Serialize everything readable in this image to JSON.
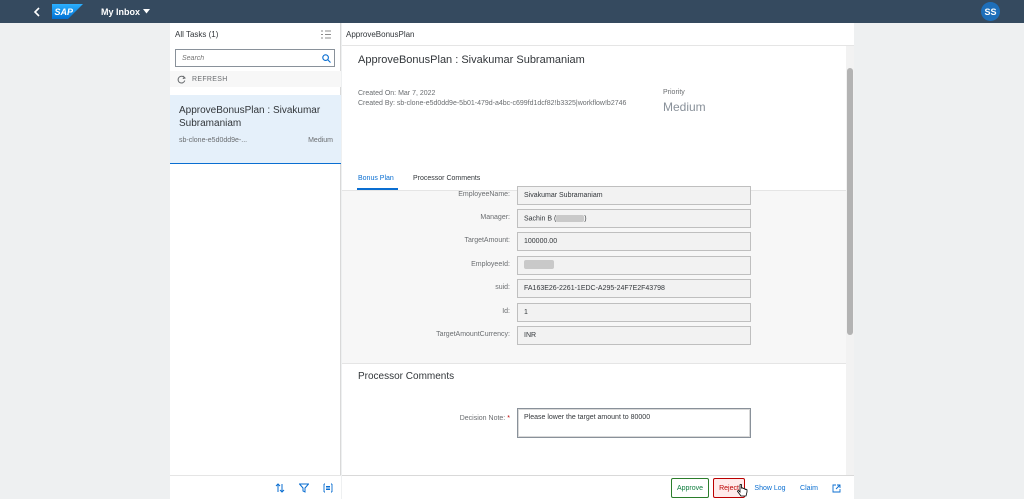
{
  "shell": {
    "brand": "SAP",
    "title": "My Inbox",
    "user_initials": "SS",
    "colors": {
      "header_bg": "#354a5f",
      "avatar_bg": "#1e6fba"
    }
  },
  "master": {
    "header_title": "All Tasks (1)",
    "search_placeholder": "Search",
    "refresh_label": "REFRESH",
    "tasks": [
      {
        "title": "ApproveBonusPlan : Sivakumar Subramaniam",
        "creator": "sb-clone-e5d0dd9e-...",
        "priority": "Medium"
      }
    ]
  },
  "detail": {
    "bar_title": "ApproveBonusPlan",
    "object_title": "ApproveBonusPlan : Sivakumar Subramaniam",
    "created_on": "Created On: Mar 7, 2022",
    "created_by": "Created By: sb-clone-e5d0dd9e-5b01-479d-a4bc-c699fd1dcf82!b3325|workflow!b2746",
    "priority_label": "Priority",
    "priority_value": "Medium",
    "tabs": [
      {
        "label": "Bonus Plan",
        "active": true
      },
      {
        "label": "Processor Comments",
        "active": false
      }
    ],
    "fields": [
      {
        "label": "EmployeeName:",
        "value": "Sivakumar Subramaniam"
      },
      {
        "label": "Manager:",
        "value": "Sachin B (",
        "value_suffix": ")"
      },
      {
        "label": "TargetAmount:",
        "value": "100000.00"
      },
      {
        "label": "EmployeeId:",
        "value": ""
      },
      {
        "label": "suid:",
        "value": "FA163E26-2261-1EDC-A295-24F7E2F43798"
      },
      {
        "label": "Id:",
        "value": "1"
      },
      {
        "label": "TargetAmountCurrency:",
        "value": "INR"
      }
    ],
    "comments_section": {
      "title": "Processor Comments",
      "note_label": "Decision Note:",
      "note_required": "*",
      "note_value": "Please lower the target amount to 80000"
    }
  },
  "footer": {
    "approve": "Approve",
    "reject": "Reject",
    "show_log": "Show Log",
    "claim": "Claim"
  }
}
